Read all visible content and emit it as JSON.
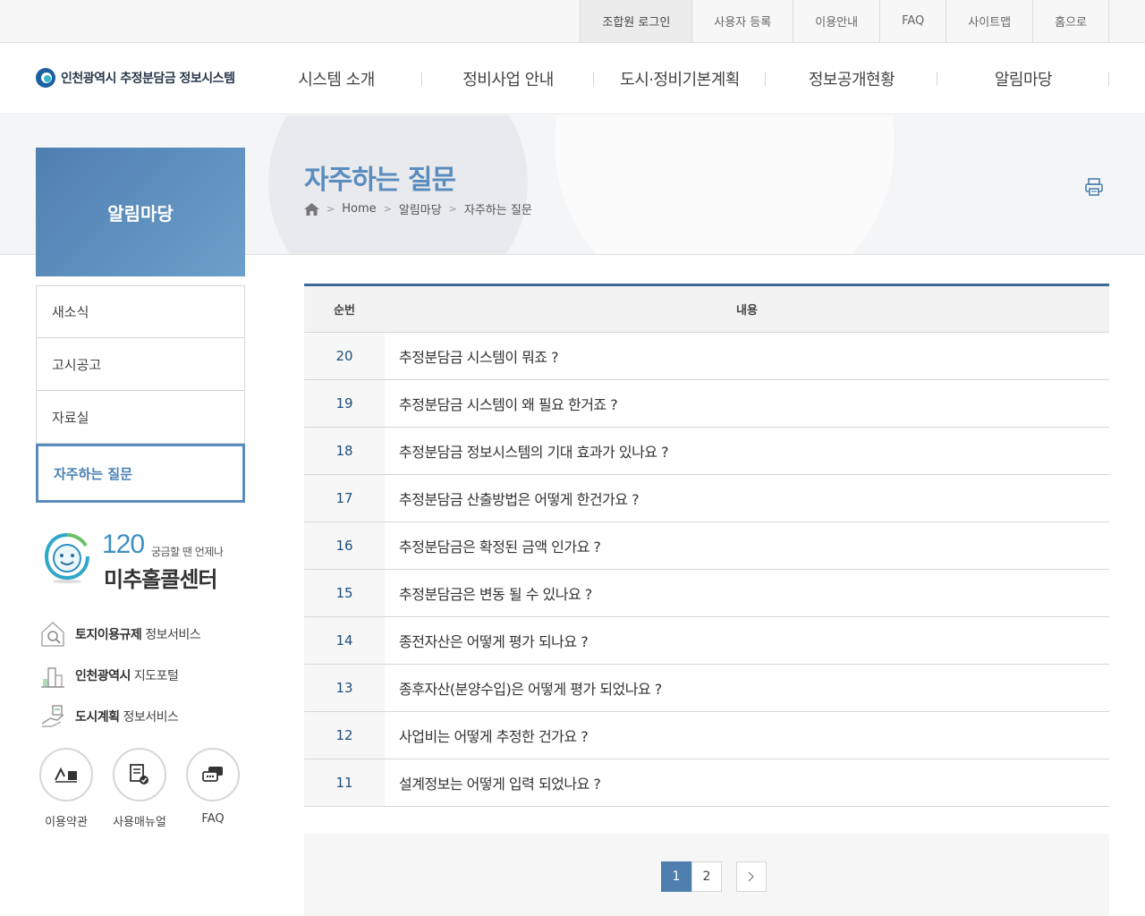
{
  "topbar": {
    "links": [
      "조합원 로그인",
      "사용자 등록",
      "이용안내",
      "FAQ",
      "사이트맵",
      "홈으로"
    ]
  },
  "header": {
    "logo_text": "인천광역시 추정분담금 정보시스템",
    "gnb": [
      "시스템 소개",
      "정비사업 안내",
      "도시·정비기본계획",
      "정보공개현황",
      "알림마당"
    ]
  },
  "lnb": {
    "title": "알림마당",
    "items": [
      "새소식",
      "고시공고",
      "자료실",
      "자주하는 질문"
    ],
    "active_index": 3
  },
  "content": {
    "page_title": "자주하는 질문",
    "breadcrumb": [
      "Home",
      "알림마당",
      "자주하는 질문"
    ]
  },
  "callcenter": {
    "number": "120",
    "tagline": "궁금할 땐 언제나",
    "name": "미추홀콜센터"
  },
  "service_links": [
    {
      "bold": "토지이용규제",
      "rest": " 정보서비스",
      "icon": "house-search-icon"
    },
    {
      "bold": "인천광역시",
      "rest": " 지도포털",
      "icon": "map-building-icon"
    },
    {
      "bold": "도시계획",
      "rest": " 정보서비스",
      "icon": "hand-plan-icon"
    }
  ],
  "quick_links": [
    {
      "label": "이용약관",
      "icon": "pen-sign-icon"
    },
    {
      "label": "사용매뉴얼",
      "icon": "document-check-icon"
    },
    {
      "label": "FAQ",
      "icon": "chat-bubble-icon"
    }
  ],
  "board": {
    "headers": [
      "순번",
      "내용"
    ],
    "rows": [
      {
        "no": "20",
        "title": "추정분담금 시스템이 뭐죠 ?"
      },
      {
        "no": "19",
        "title": "추정분담금 시스템이 왜 필요 한거죠 ?"
      },
      {
        "no": "18",
        "title": "추정분담금 정보시스템의 기대 효과가 있나요 ?"
      },
      {
        "no": "17",
        "title": "추정분담금 산출방법은 어떻게 한건가요 ?"
      },
      {
        "no": "16",
        "title": "추정분담금은 확정된 금액 인가요 ?"
      },
      {
        "no": "15",
        "title": "추정분담금은 변동 될 수 있나요 ?"
      },
      {
        "no": "14",
        "title": "종전자산은 어떻게 평가 되나요 ?"
      },
      {
        "no": "13",
        "title": "종후자산(분양수입)은 어떻게 평가 되었나요 ?"
      },
      {
        "no": "12",
        "title": "사업비는 어떻게 추정한 건가요 ?"
      },
      {
        "no": "11",
        "title": "설계정보는 어떻게 입력 되었나요 ?"
      }
    ]
  },
  "pagination": {
    "pages": [
      "1",
      "2"
    ],
    "current": "1",
    "next_label": "›"
  },
  "colors": {
    "accent": "#5a8dbd",
    "board_top": "#3b6a96",
    "number_text": "#1f4f7d"
  }
}
